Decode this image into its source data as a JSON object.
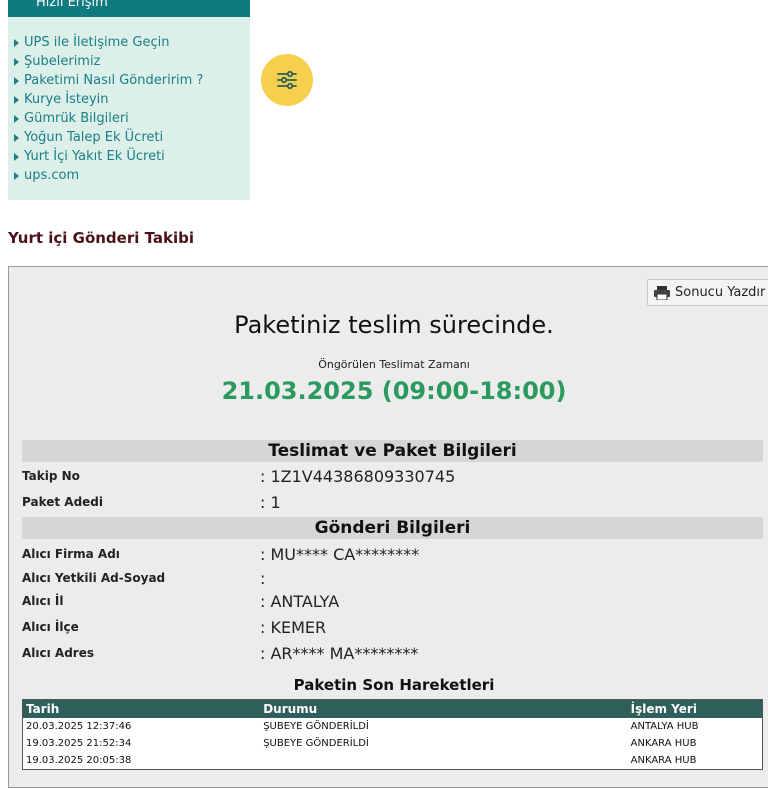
{
  "quick_access": {
    "title": "Hızlı Erişim",
    "links": [
      "UPS ile İletişime Geçin",
      "Şubelerimiz",
      "Paketimi Nasıl Gönderirim ?",
      "Kurye İsteyin",
      "Gümrük Bilgileri",
      "Yoğun Talep Ek Ücreti",
      "Yurt İçi Yakıt Ek Ücreti",
      "ups.com"
    ]
  },
  "section_title": "Yurt içi Gönderi Takibi",
  "result": {
    "print_label": "Sonucu Yazdır",
    "headline": "Paketiniz teslim sürecinde.",
    "estimate_label": "Öngörülen Teslimat Zamanı",
    "estimate_value": "21.03.2025 (09:00-18:00)"
  },
  "package_info": {
    "title": "Teslimat ve Paket Bilgileri",
    "rows": [
      {
        "label": "Takip No",
        "value": ": 1Z1V44386809330745"
      },
      {
        "label": "Paket Adedi",
        "value": ": 1"
      }
    ]
  },
  "shipment_info": {
    "title": "Gönderi Bilgileri",
    "rows": [
      {
        "label": "Alıcı Firma Adı",
        "value": ": MU**** CA********"
      },
      {
        "label": "Alıcı Yetkili Ad-Soyad",
        "value": ":"
      },
      {
        "label": "Alıcı İl",
        "value": ": ANTALYA"
      },
      {
        "label": "Alıcı İlçe",
        "value": ": KEMER"
      },
      {
        "label": "Alıcı Adres",
        "value": ": AR**** MA********"
      }
    ]
  },
  "movements": {
    "title": "Paketin Son Hareketleri",
    "headers": [
      "Tarih",
      "Durumu",
      "İşlem Yeri"
    ],
    "rows": [
      [
        "20.03.2025 12:37:46",
        "ŞUBEYE GÖNDERİLDİ",
        "ANTALYA HUB"
      ],
      [
        "19.03.2025 21:52:34",
        "ŞUBEYE GÖNDERİLDİ",
        "ANKARA HUB"
      ],
      [
        "19.03.2025 20:05:38",
        "",
        "ANKARA HUB"
      ]
    ]
  },
  "colors": {
    "teal_header": "#0f7a80",
    "link": "#1a7f86",
    "quick_bg": "#dcefe9",
    "filter_button": "#f6d04d",
    "date_green": "#2a9a5e",
    "table_header": "#2e5f5b",
    "section_title": "#4a1216"
  },
  "icons": {
    "filter": "sliders-icon",
    "print": "printer-icon",
    "link_marker": "triangle-right-icon"
  }
}
